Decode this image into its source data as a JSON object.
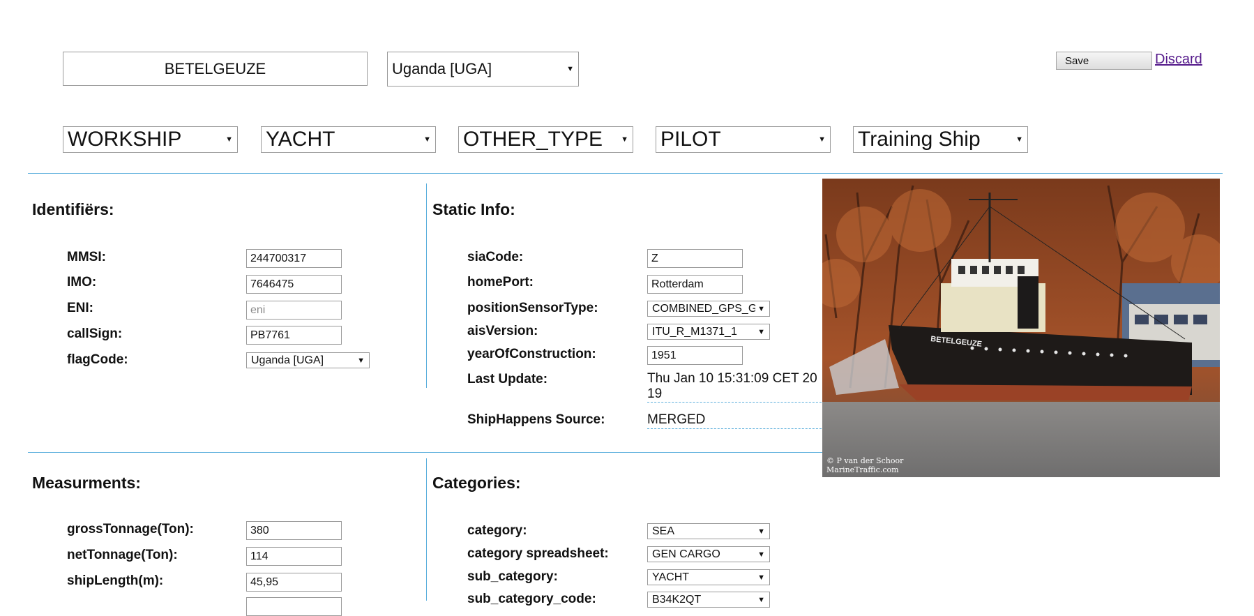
{
  "header": {
    "ship_name": "BETELGEUZE",
    "country": "Uganda [UGA]",
    "save_label": "Save",
    "discard_label": "Discard"
  },
  "type_selects": [
    "WORKSHIP",
    "YACHT",
    "OTHER_TYPE",
    "PILOT",
    "Training Ship"
  ],
  "identifiers": {
    "heading": "Identifiërs:",
    "fields": [
      {
        "label": "MMSI:",
        "value": "244700317"
      },
      {
        "label": "IMO:",
        "value": "7646475"
      },
      {
        "label": "ENI:",
        "placeholder": "eni"
      },
      {
        "label": "callSign:",
        "value": "PB7761"
      },
      {
        "label": "flagCode:",
        "value": "Uganda [UGA]"
      }
    ]
  },
  "static_info": {
    "heading": "Static Info:",
    "fields": [
      {
        "label": "siaCode:",
        "value": "Z"
      },
      {
        "label": "homePort:",
        "value": "Rotterdam"
      },
      {
        "label": "positionSensorType:",
        "value": "COMBINED_GPS_GLONASS"
      },
      {
        "label": "aisVersion:",
        "value": "ITU_R_M1371_1"
      },
      {
        "label": "yearOfConstruction:",
        "value": "1951"
      },
      {
        "label": "Last Update:",
        "value_line1": "Thu Jan 10 15:31:09 CET 20",
        "value_line2": "19"
      },
      {
        "label": "ShipHappens Source:",
        "value": "MERGED"
      }
    ]
  },
  "photo": {
    "ship_lettering": "BETELGEUZE",
    "credit_line1": "© P van der Schoor",
    "credit_line2": "MarineTraffic.com"
  },
  "measurements": {
    "heading": "Measurments:",
    "fields": [
      {
        "label": "grossTonnage(Ton):",
        "value": "380"
      },
      {
        "label": "netTonnage(Ton):",
        "value": "114"
      },
      {
        "label": "shipLength(m):",
        "value": "45,95"
      }
    ]
  },
  "categories": {
    "heading": "Categories:",
    "fields": [
      {
        "label": "category:",
        "value": "SEA"
      },
      {
        "label": "category spreadsheet:",
        "value": "GEN CARGO"
      },
      {
        "label": "sub_category:",
        "value": "YACHT"
      },
      {
        "label": "sub_category_code:",
        "value": "B34K2QT"
      }
    ]
  },
  "colors": {
    "divider": "#5aaedc",
    "link": "#551a8b"
  }
}
